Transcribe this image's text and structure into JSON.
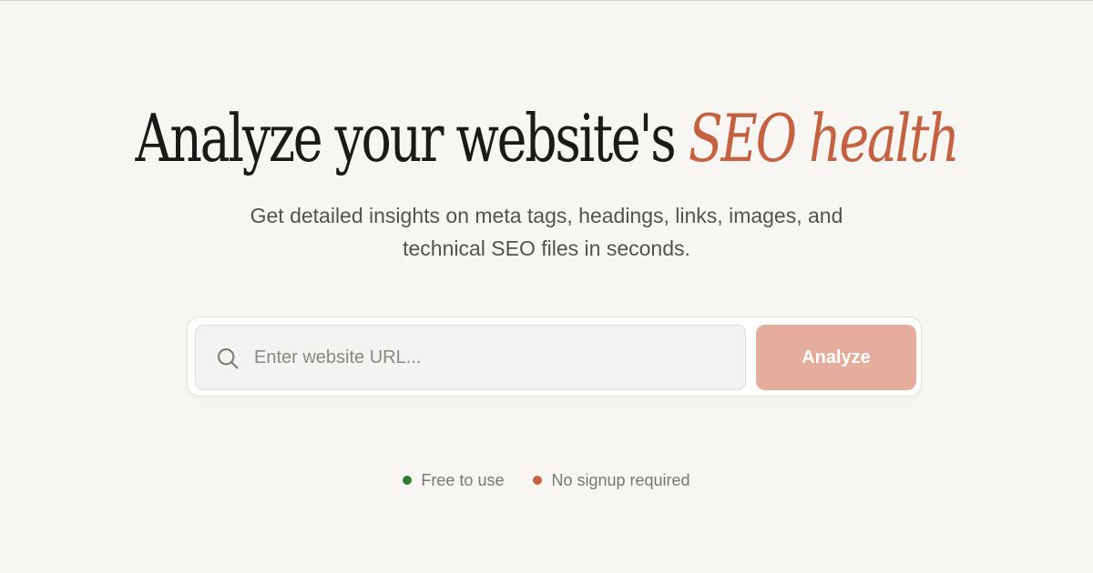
{
  "hero": {
    "title_main": "Analyze your website's ",
    "title_accent": "SEO health",
    "subtitle_line1": "Get detailed insights on meta tags, headings, links, images, and",
    "subtitle_line2": "technical SEO files in seconds."
  },
  "search": {
    "placeholder": "Enter website URL...",
    "value": "",
    "icon": "search-icon",
    "button_label": "Analyze"
  },
  "badges": [
    {
      "label": "Free to use",
      "color": "#2e7d32"
    },
    {
      "label": "No signup required",
      "color": "#c4623f"
    }
  ],
  "colors": {
    "background": "#f8f6f3",
    "accent": "#c4623f",
    "button": "#e5ad9c",
    "headline": "#1c1a18"
  }
}
